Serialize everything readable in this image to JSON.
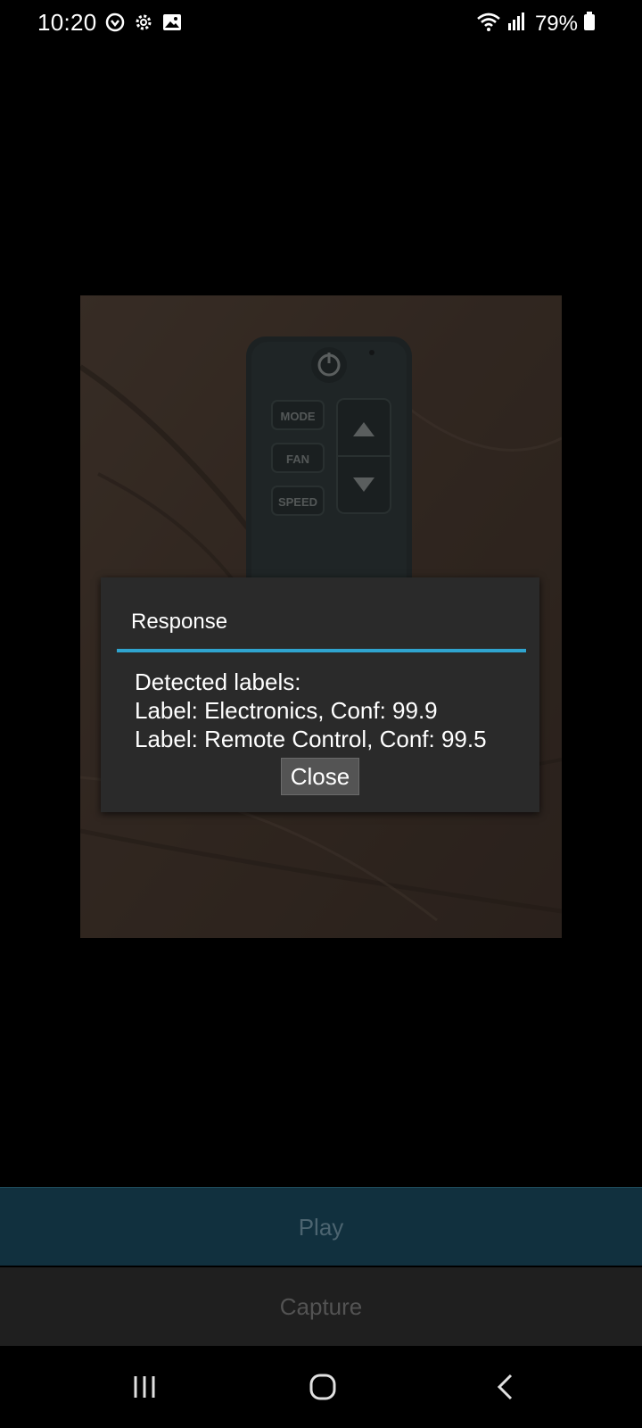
{
  "status_bar": {
    "time": "10:20",
    "battery": "79%",
    "icons": [
      "notification-app-icon",
      "settings-gear-icon",
      "gallery-icon",
      "wifi-icon",
      "signal-icon",
      "battery-icon"
    ]
  },
  "preview": {
    "remote_buttons": [
      "MODE",
      "FAN",
      "SPEED"
    ]
  },
  "dialog": {
    "title": "Response",
    "accent_color": "#2fa4cf",
    "heading": "Detected labels:",
    "labels": [
      "Label: Electronics, Conf: 99.9",
      "Label: Remote Control, Conf: 99.5"
    ],
    "close_label": "Close"
  },
  "actions": {
    "play_label": "Play",
    "capture_label": "Capture"
  },
  "nav": {
    "icons": [
      "recent-apps-icon",
      "home-icon",
      "back-icon"
    ]
  }
}
